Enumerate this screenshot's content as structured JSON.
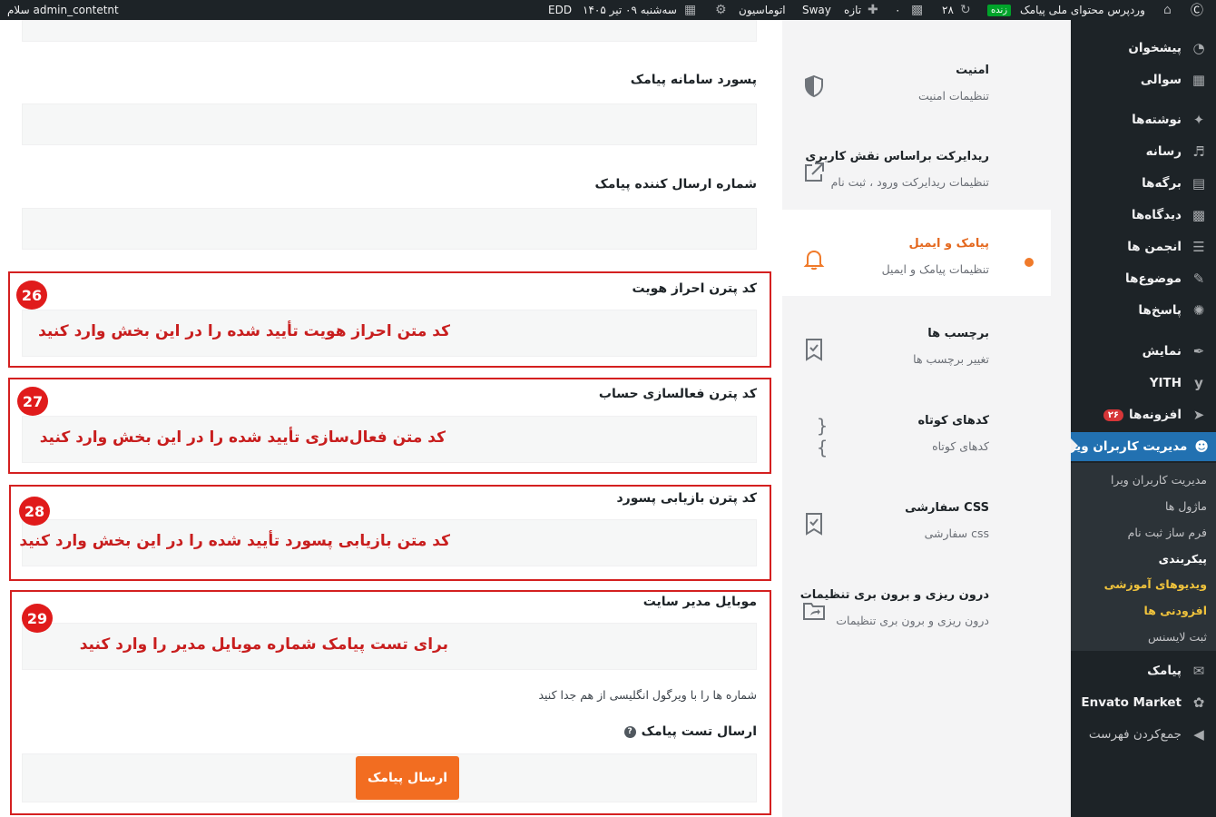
{
  "adminbar": {
    "greeting": "سلام admin_contetnt",
    "edd": "EDD",
    "date": "سه‌شنبه ۰۹ تیر ۱۴۰۵",
    "automation": "اتوماسیون",
    "sway": "Sway",
    "new": "تازه",
    "comments_count": "۰",
    "updates_count": "۲۸",
    "live": "زنده",
    "site_name": "وردپرس محتوای ملی پیامک"
  },
  "sidebar": {
    "items": [
      {
        "label": "پیشخوان",
        "icon": "dashboard-icon"
      },
      {
        "label": "سوالی",
        "icon": "table-icon"
      },
      {
        "label": "نوشته‌ها",
        "icon": "pin-icon"
      },
      {
        "label": "رسانه",
        "icon": "media-icon"
      },
      {
        "label": "برگه‌ها",
        "icon": "pages-icon"
      },
      {
        "label": "دیدگاه‌ها",
        "icon": "comment-icon"
      },
      {
        "label": "انجمن ها",
        "icon": "forum-icon"
      },
      {
        "label": "موضوع‌ها",
        "icon": "topics-icon"
      },
      {
        "label": "پاسخ‌ها",
        "icon": "replies-icon"
      },
      {
        "label": "نمایش",
        "icon": "appearance-icon"
      },
      {
        "label": "YITH",
        "icon": "yith-icon"
      },
      {
        "label": "افزونه‌ها",
        "icon": "plugins-icon",
        "badge": "۲۶"
      },
      {
        "label": "مدیریت کاربران ویرا",
        "icon": "users-icon"
      },
      {
        "label": "پیامک",
        "icon": "mail-icon"
      },
      {
        "label": "Envato Market",
        "icon": "envato-icon"
      },
      {
        "label": "جمع‌کردن فهرست",
        "icon": "collapse-icon"
      }
    ],
    "submenu": [
      "مدیریت کاربران ویرا",
      "ماژول ها",
      "فرم ساز ثبت نام",
      "پیکربندی",
      "ویدیوهای آموزشی",
      "افزودنی ها",
      "ثبت لایسنس"
    ]
  },
  "settings_nav": [
    {
      "title": "امنیت",
      "subtitle": "تنظیمات امنیت",
      "icon": "shield-icon"
    },
    {
      "title": "ریدایرکت براساس نقش کاربری",
      "subtitle": "تنظیمات ریدایرکت ورود ، ثبت نام",
      "icon": "external-link-icon"
    },
    {
      "title": "پیامک و ایمیل",
      "subtitle": "تنظیمات پیامک و ایمیل",
      "icon": "bell-icon"
    },
    {
      "title": "برچسب ها",
      "subtitle": "تغییر برچسب ها",
      "icon": "bookmark-icon"
    },
    {
      "title": "کدهای کوتاه",
      "subtitle": "کدهای کوتاه",
      "icon": "braces-icon"
    },
    {
      "title": "CSS سفارشی",
      "subtitle": "css سفارشی",
      "icon": "bookmark-icon"
    },
    {
      "title": "درون ریزی و برون بری تنظیمات",
      "subtitle": "درون ریزی و برون بری تنظیمات",
      "icon": "folder-share-icon"
    }
  ],
  "form": {
    "sms_password_label": "پسورد سامانه پیامک",
    "sender_number_label": "شماره ارسال کننده پیامک",
    "auth_pattern_label": "کد پترن احراز هویت",
    "activation_pattern_label": "کد پترن فعالسازی حساب",
    "recovery_pattern_label": "کد پترن بازیابی پسورد",
    "admin_mobile_label": "موبایل مدیر سایت",
    "admin_mobile_help": "شماره ها را با ویرگول انگلیسی از هم جدا کنید",
    "test_sms_label": "ارسال تست پیامک",
    "send_button": "ارسال پیامک"
  },
  "annotations": [
    {
      "number": "26",
      "text": "کد متن احراز هویت تأیید شده را در این بخش وارد کنید"
    },
    {
      "number": "27",
      "text": "کد متن فعال‌سازی تأیید شده را در این بخش وارد کنید"
    },
    {
      "number": "28",
      "text": "کد متن بازیابی پسورد تأیید شده را در این بخش وارد کنید"
    },
    {
      "number": "29",
      "text": "برای تست پیامک شماره موبایل مدیر را وارد کنید"
    }
  ],
  "colors": {
    "admin_dark": "#1d2327",
    "active_menu": "#2271b1",
    "accent_orange": "#f26d21",
    "annotation_red": "#d42020"
  }
}
